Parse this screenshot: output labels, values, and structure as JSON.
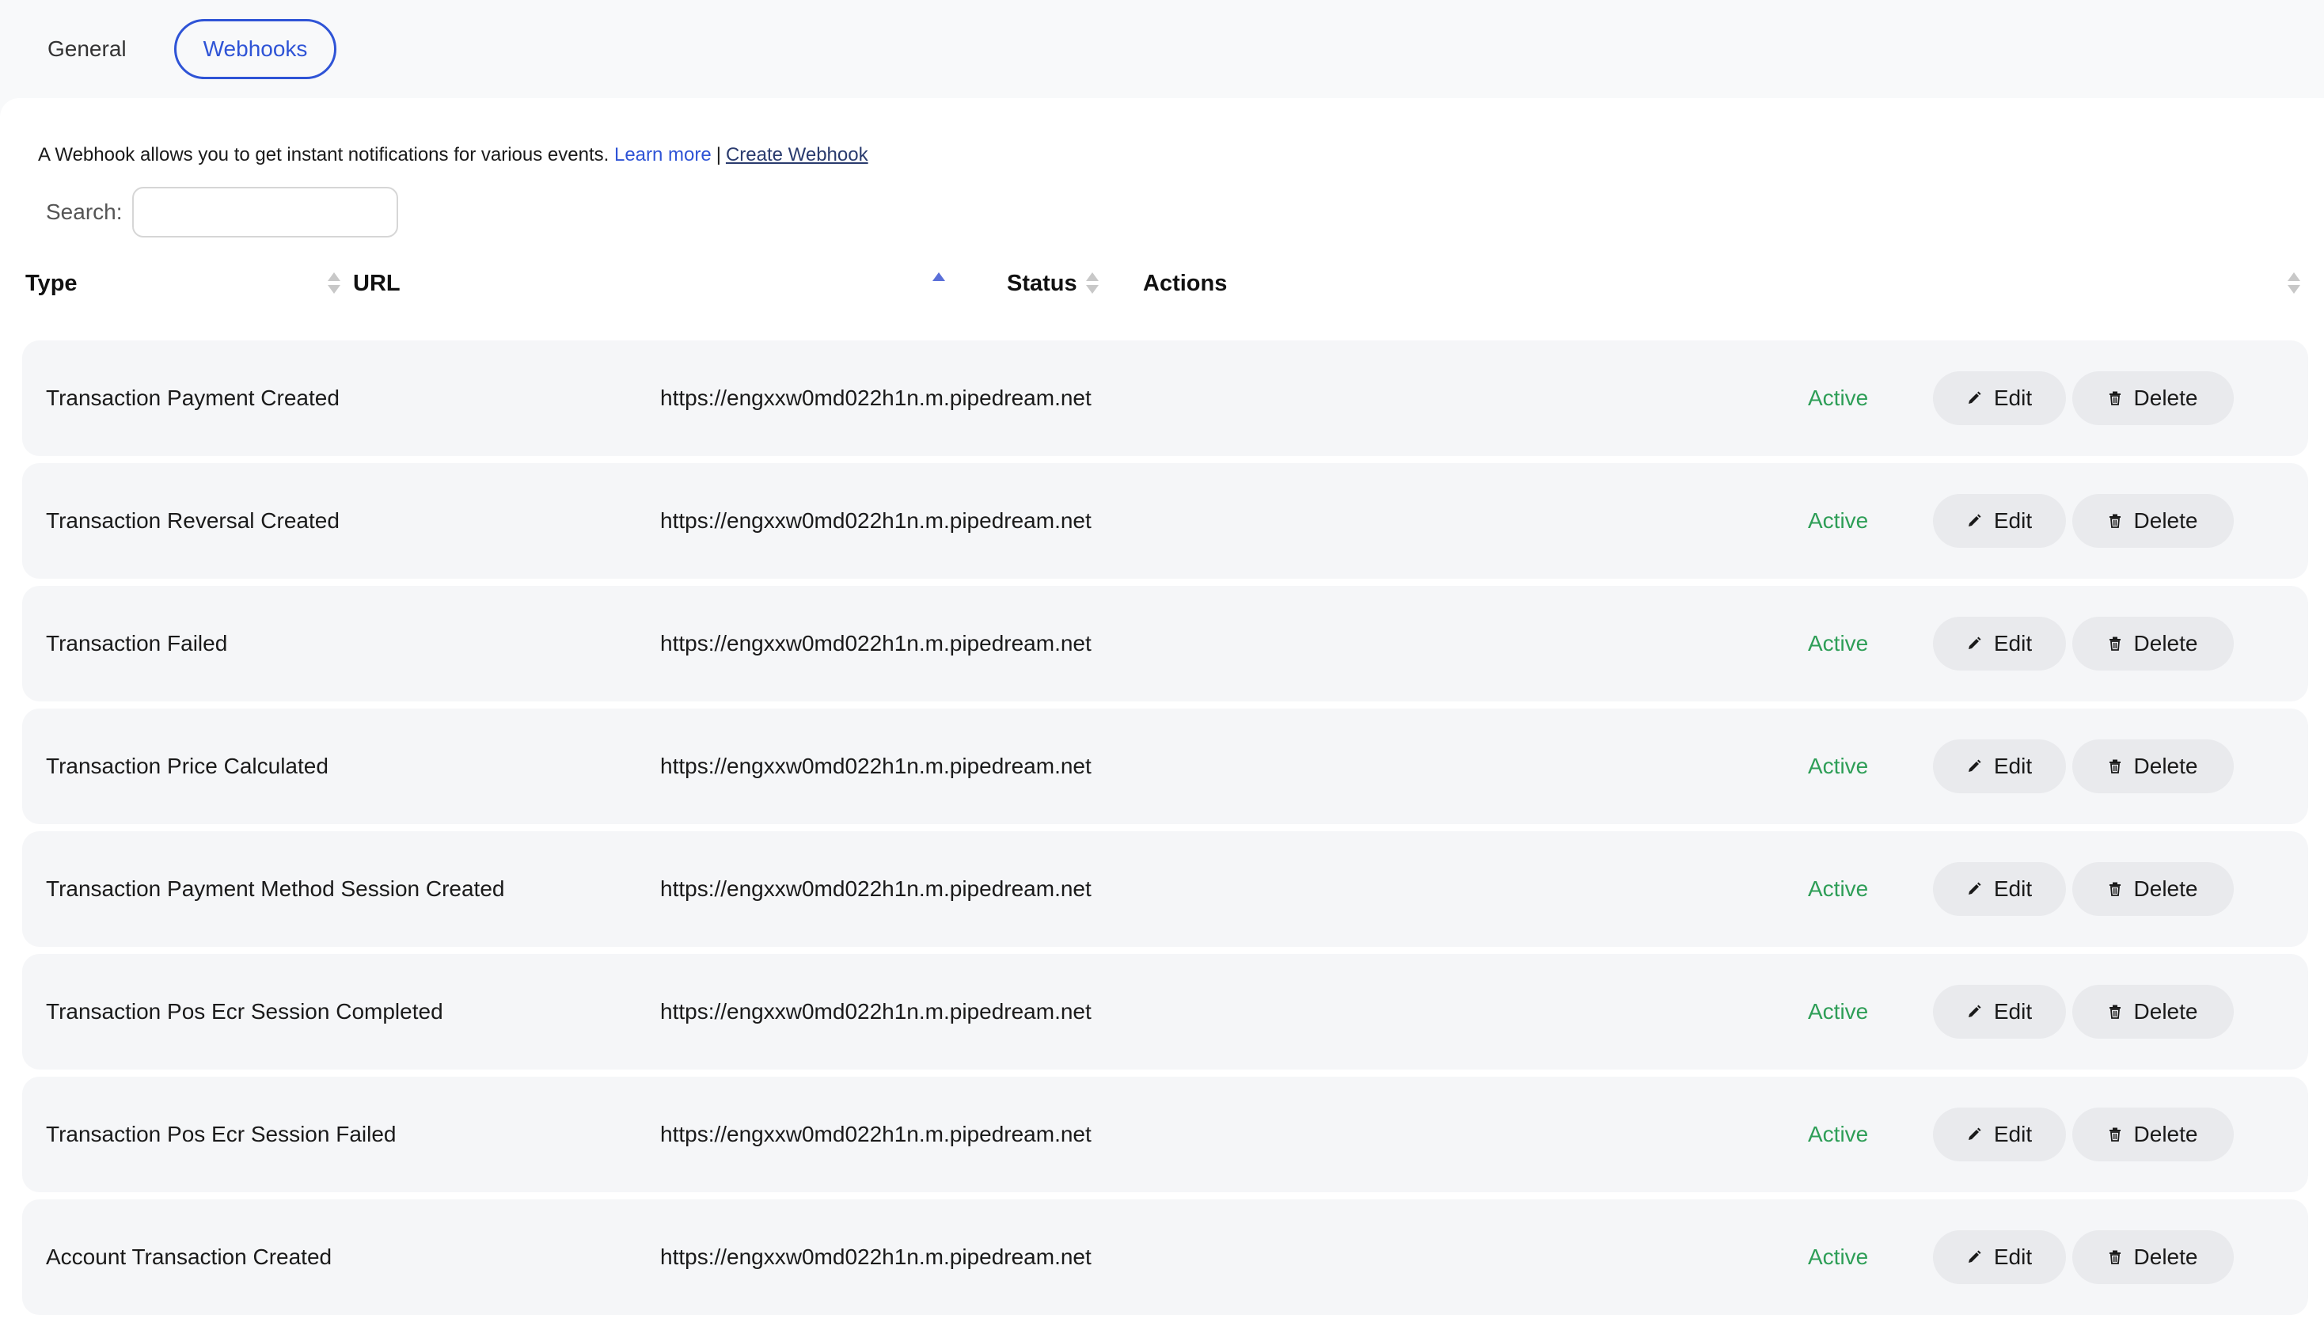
{
  "tabs": [
    {
      "label": "General",
      "active": false
    },
    {
      "label": "Webhooks",
      "active": true
    }
  ],
  "intro": {
    "text": "A Webhook allows you to get instant notifications for various events.",
    "learn_more": "Learn more",
    "separator": "|",
    "create_webhook": "Create Webhook"
  },
  "search": {
    "label": "Search:",
    "value": "",
    "placeholder": ""
  },
  "table": {
    "columns": [
      {
        "label": "Type",
        "sort": "none"
      },
      {
        "label": "URL",
        "sort": "ascending"
      },
      {
        "label": "Status",
        "sort": "none"
      },
      {
        "label": "Actions",
        "sort": "none"
      }
    ],
    "edit_label": "Edit",
    "delete_label": "Delete",
    "rows": [
      {
        "type": "Transaction Payment Created",
        "url": "https://engxxw0md022h1n.m.pipedream.net",
        "status": "Active"
      },
      {
        "type": "Transaction Reversal Created",
        "url": "https://engxxw0md022h1n.m.pipedream.net",
        "status": "Active"
      },
      {
        "type": "Transaction Failed",
        "url": "https://engxxw0md022h1n.m.pipedream.net",
        "status": "Active"
      },
      {
        "type": "Transaction Price Calculated",
        "url": "https://engxxw0md022h1n.m.pipedream.net",
        "status": "Active"
      },
      {
        "type": "Transaction Payment Method Session Created",
        "url": "https://engxxw0md022h1n.m.pipedream.net",
        "status": "Active"
      },
      {
        "type": "Transaction Pos Ecr Session Completed",
        "url": "https://engxxw0md022h1n.m.pipedream.net",
        "status": "Active"
      },
      {
        "type": "Transaction Pos Ecr Session Failed",
        "url": "https://engxxw0md022h1n.m.pipedream.net",
        "status": "Active"
      },
      {
        "type": "Account Transaction Created",
        "url": "https://engxxw0md022h1n.m.pipedream.net",
        "status": "Active"
      }
    ]
  },
  "colors": {
    "accent": "#2f54d6",
    "status_active": "#2e9e57",
    "row_background": "#f5f6f8",
    "button_background": "#e9eaed"
  },
  "icons": {
    "edit": "pencil-icon",
    "delete": "trash-icon"
  }
}
